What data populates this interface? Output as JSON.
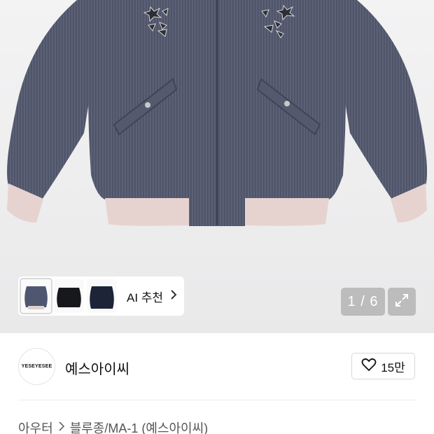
{
  "product_image": {
    "alt_icon": "jacket-photo",
    "jacket_color": "#5a6074",
    "rib_color": "#e6d3cf"
  },
  "thumbnails": [
    {
      "name": "thumb-jacket-gray",
      "color": "#4f5670",
      "selected": true
    },
    {
      "name": "thumb-jacket-black",
      "color": "#17181c",
      "selected": false
    },
    {
      "name": "thumb-jacket-navy",
      "color": "#1d2438",
      "selected": false
    }
  ],
  "ai_recommend": {
    "label": "AI 추천",
    "icon": "chevron-right-icon"
  },
  "pager": {
    "current": "1",
    "total": "6",
    "label": "1 / 6"
  },
  "expand": {
    "icon": "expand-icon"
  },
  "brand": {
    "logo_text": "YESEYESEE",
    "name": "예스아이씨"
  },
  "like": {
    "icon": "heart-icon",
    "count": "15만"
  },
  "breadcrumb": {
    "items": [
      "아우터",
      "블루종/MA-1 (예스아이씨)"
    ]
  }
}
